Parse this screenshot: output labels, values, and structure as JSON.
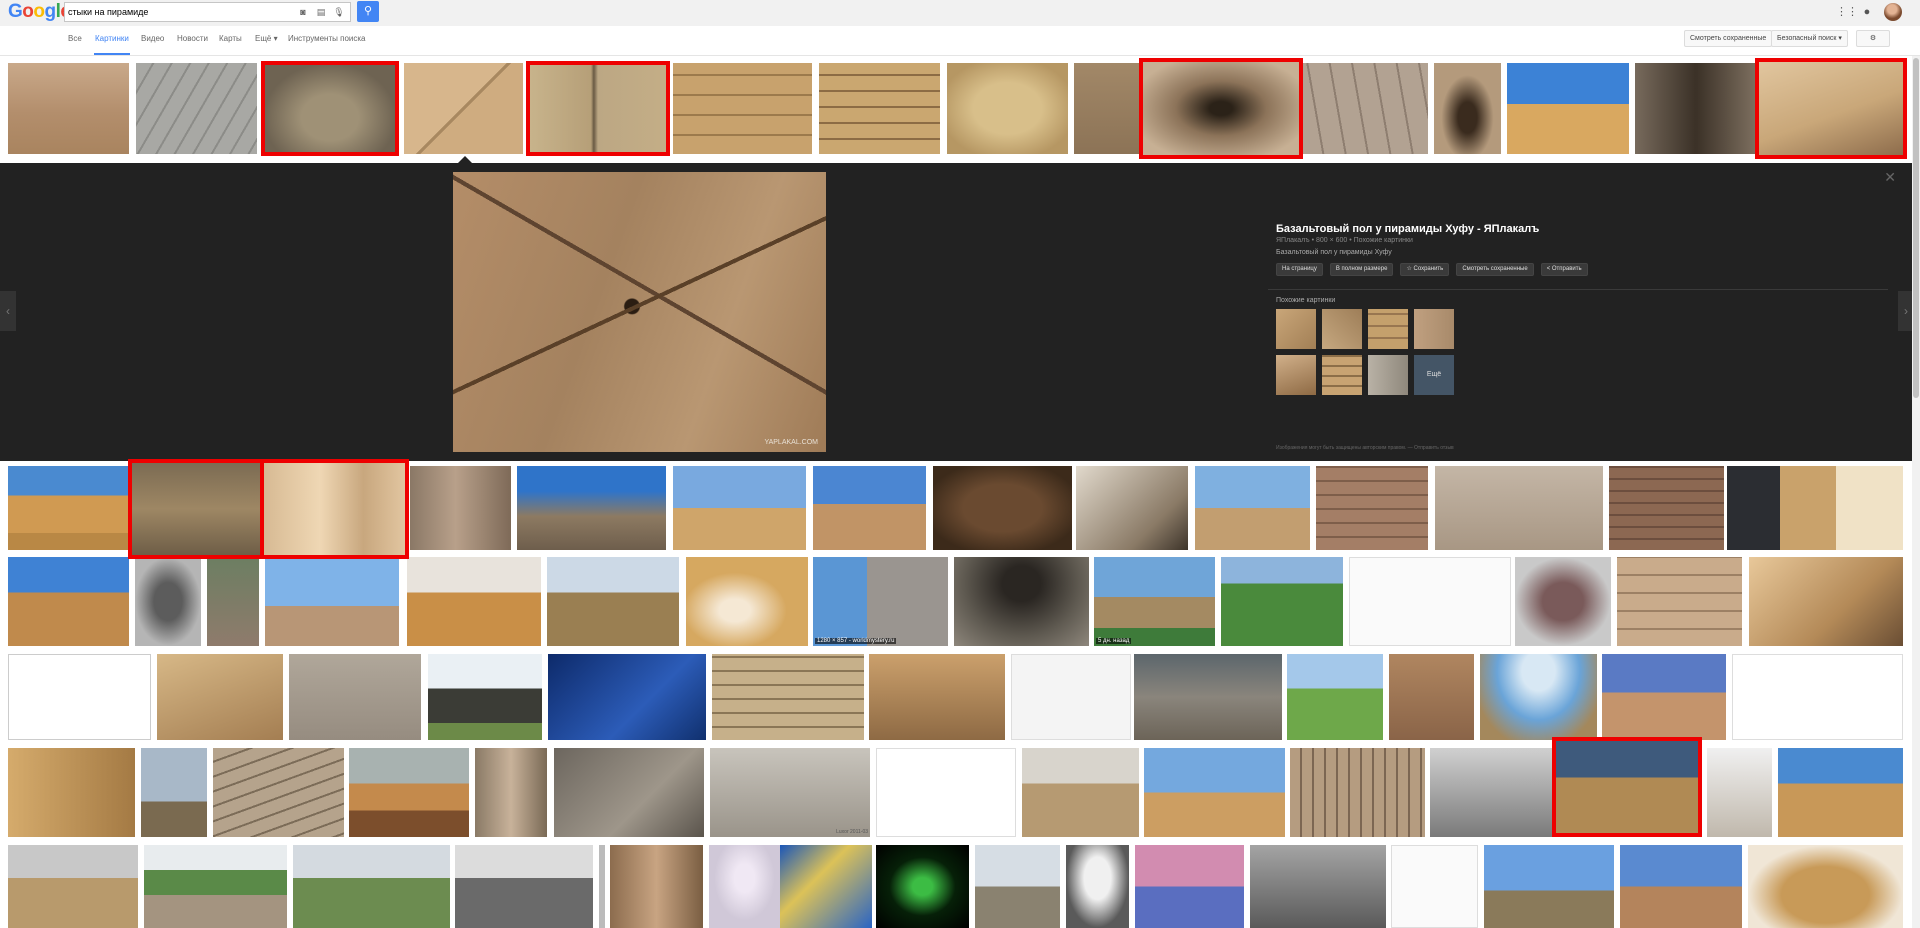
{
  "header": {
    "logo_letters": [
      {
        "ch": "G",
        "color": "#4285f4"
      },
      {
        "ch": "o",
        "color": "#ea4335"
      },
      {
        "ch": "o",
        "color": "#fbbc05"
      },
      {
        "ch": "g",
        "color": "#4285f4"
      },
      {
        "ch": "l",
        "color": "#34a853"
      },
      {
        "ch": "e",
        "color": "#ea4335"
      }
    ],
    "search_query": "стыки на пирамиде",
    "icons": [
      "camera-icon",
      "keyboard-icon",
      "microphone-icon",
      "search-icon",
      "apps-grid-icon",
      "notifications-icon"
    ]
  },
  "nav": {
    "tabs": [
      "Все",
      "Картинки",
      "Видео",
      "Новости",
      "Карты",
      "Ещё ▾",
      "Инструменты поиска"
    ],
    "active_tab": 1,
    "saved_label": "Смотреть сохраненные",
    "safesearch_label": "Безопасный поиск ▾",
    "settings_icon": "gear-icon"
  },
  "preview": {
    "title": "Базальтовый пол у пирамиды Хуфу - ЯПлакалъ",
    "source": "ЯПлакалъ • 800 × 600 • Похожие картинки",
    "description": "Базальтовый пол у пирамиды Хуфу",
    "watermark": "YAPLAKAL.COM",
    "buttons": [
      "На страницу",
      "В полном размере",
      "☆ Сохранить",
      "Смотреть сохраненные",
      "< Отправить"
    ],
    "related_label": "Похожие картинки",
    "more_label": "Ещё",
    "footer_text": "Изображения могут быть защищены авторским правом. — Отправить отзыв"
  },
  "thumb_overlays": {
    "r3_size": "1280 × 857 - worldmystery.ru",
    "r3_time": "5 дн. назад",
    "r5_caption": "Luxor 2011-03"
  },
  "colors": {
    "accent": "#4285f4",
    "highlight": "#e00000",
    "preview_bg": "#222222"
  }
}
